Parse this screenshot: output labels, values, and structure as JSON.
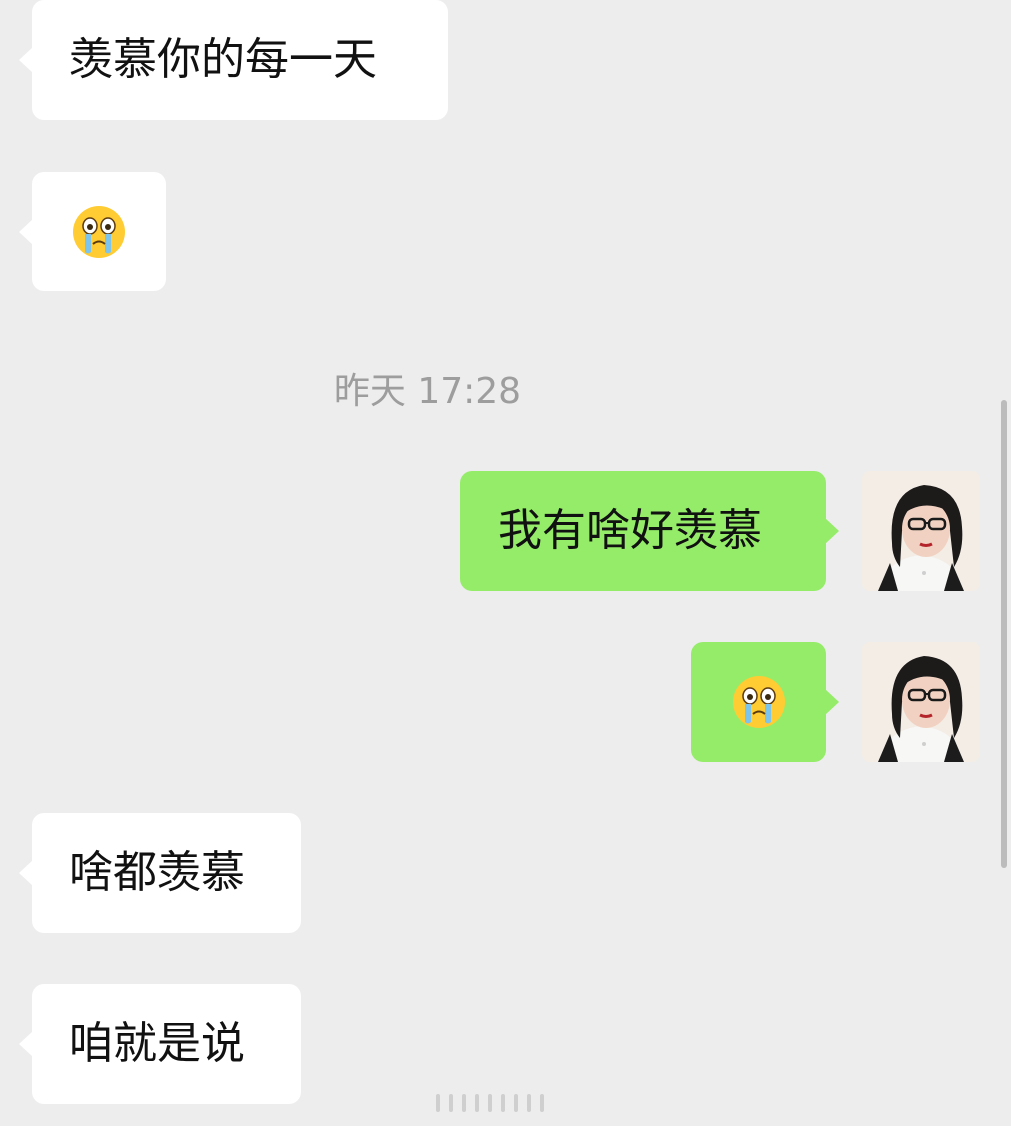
{
  "messages": [
    {
      "side": "left",
      "type": "text",
      "text": "羡慕你的每一天"
    },
    {
      "side": "left",
      "type": "emoji",
      "icon": "crying-face-icon"
    },
    {
      "side": "right",
      "type": "text",
      "text": "我有啥好羡慕"
    },
    {
      "side": "right",
      "type": "emoji",
      "icon": "crying-face-icon"
    },
    {
      "side": "left",
      "type": "text",
      "text": "啥都羡慕"
    },
    {
      "side": "left",
      "type": "text",
      "text": "咱就是说"
    }
  ],
  "timestamp": "昨天 17:28",
  "colors": {
    "background": "#ededed",
    "incoming_bubble": "#ffffff",
    "outgoing_bubble": "#95ec69",
    "timestamp_text": "#9d9d9d"
  }
}
